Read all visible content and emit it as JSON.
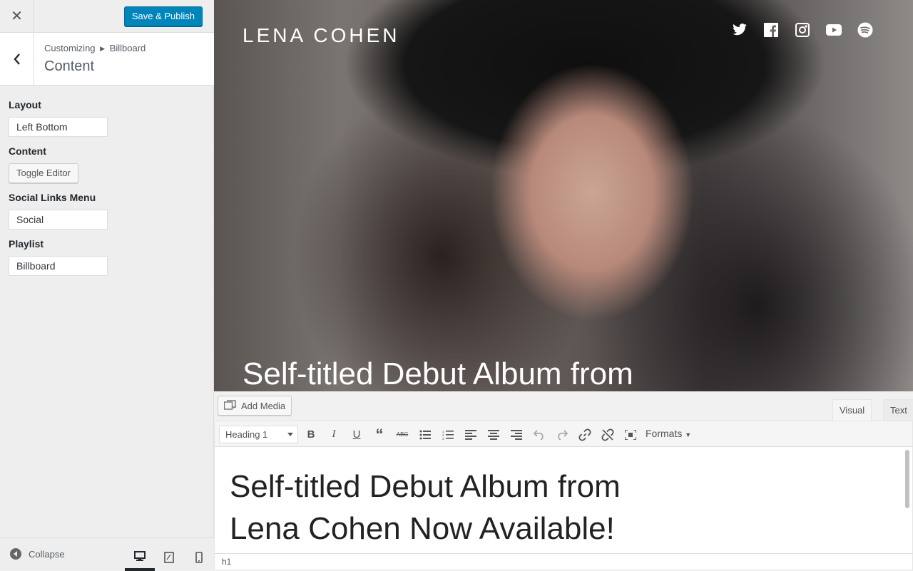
{
  "header": {
    "close_icon": "close-icon",
    "publish_label": "Save & Publish",
    "accent": "#0085ba"
  },
  "section": {
    "crumb_root": "Customizing",
    "crumb_current": "Billboard",
    "title": "Content"
  },
  "controls": {
    "layout_label": "Layout",
    "layout_value": "Left Bottom",
    "content_label": "Content",
    "toggle_editor_label": "Toggle Editor",
    "social_label": "Social Links Menu",
    "social_value": "Social",
    "playlist_label": "Playlist",
    "playlist_value": "Billboard"
  },
  "footer": {
    "collapse_label": "Collapse",
    "devices": [
      "desktop-icon",
      "tablet-icon",
      "mobile-icon"
    ],
    "active_device": "desktop"
  },
  "preview": {
    "site_title": "LENA COHEN",
    "social_icons": [
      "twitter-icon",
      "facebook-icon",
      "instagram-icon",
      "youtube-icon",
      "spotify-icon"
    ],
    "hero_text": "Self-titled Debut Album from"
  },
  "editor": {
    "add_media_label": "Add Media",
    "tab_visual": "Visual",
    "tab_text": "Text",
    "format_value": "Heading 1",
    "formats_label": "Formats",
    "heading_line1": "Self-titled Debut Album from",
    "heading_line2": "Lena Cohen Now Available!",
    "status_path": "h1"
  }
}
